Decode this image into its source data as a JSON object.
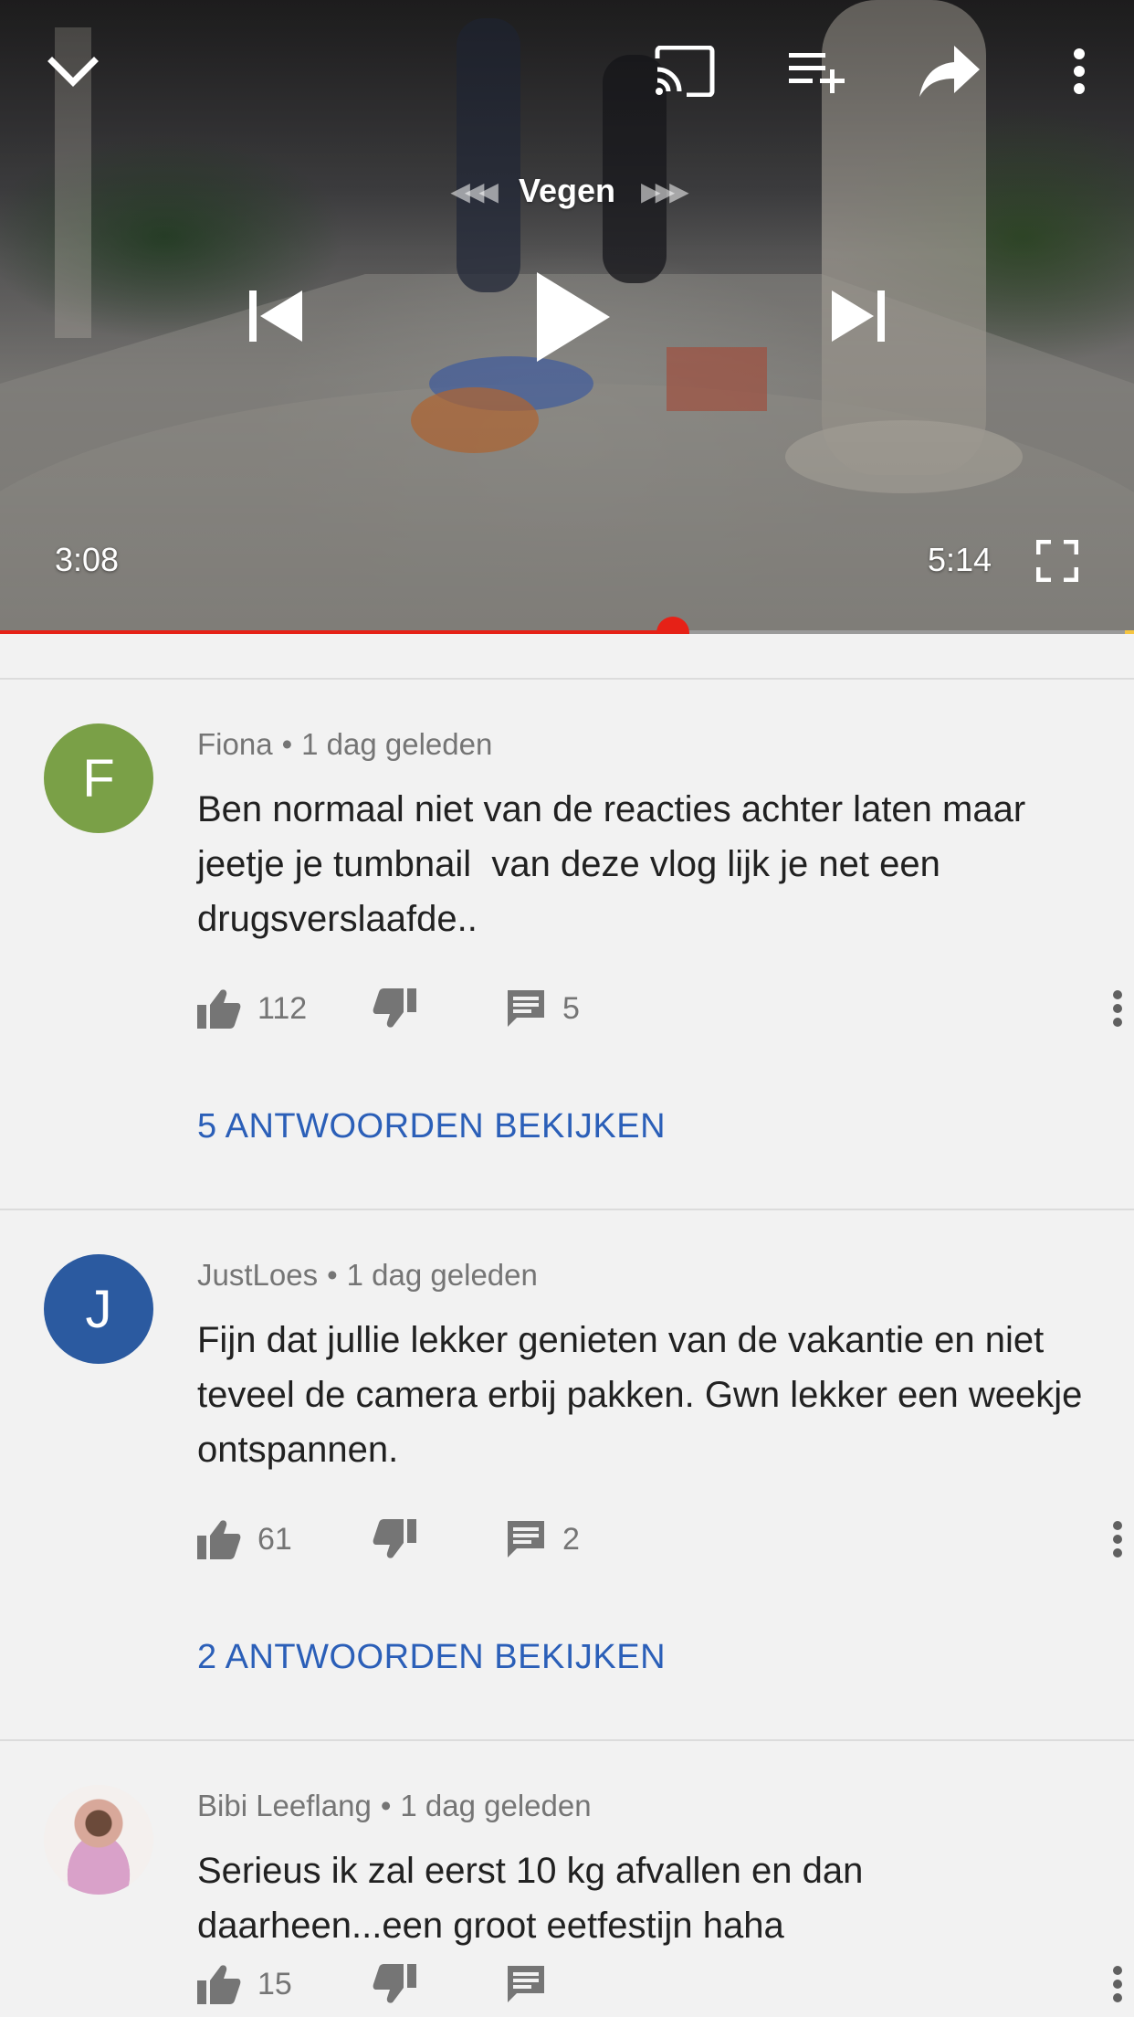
{
  "player": {
    "swipe_label": "Vegen",
    "current_time": "3:08",
    "duration": "5:14",
    "progress": 0.593
  },
  "colors": {
    "accent_red": "#e62117",
    "link_blue": "#2b5fb8",
    "avatar_green": "#7aa047",
    "avatar_blue": "#2b5aa0"
  },
  "comments": [
    {
      "author": "Fiona",
      "separator": "•",
      "time": "1 dag geleden",
      "avatar_letter": "F",
      "text": "Ben normaal niet van de reacties achter laten maar jeetje je tumbnail  van deze vlog lijk je net een drugsverslaafde..",
      "likes": "112",
      "replies": "5",
      "view_replies": "5 ANTWOORDEN BEKIJKEN"
    },
    {
      "author": "JustLoes",
      "separator": "•",
      "time": "1 dag geleden",
      "avatar_letter": "J",
      "text": "Fijn dat jullie lekker genieten van de vakantie en niet teveel de camera erbij pakken. Gwn lekker een weekje ontspannen.",
      "likes": "61",
      "replies": "2",
      "view_replies": "2 ANTWOORDEN BEKIJKEN"
    },
    {
      "author": "Bibi Leeflang",
      "separator": "•",
      "time": "1 dag geleden",
      "text": "Serieus ik zal eerst 10 kg afvallen en dan daarheen...een groot eetfestijn haha",
      "likes": "15"
    }
  ]
}
